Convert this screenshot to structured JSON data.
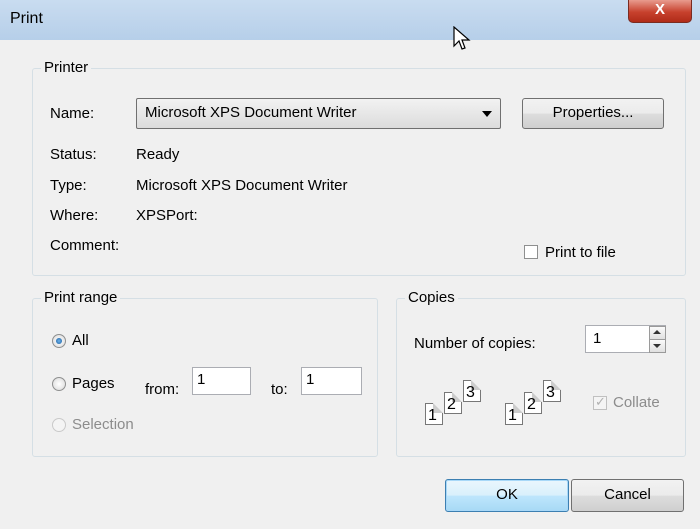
{
  "window": {
    "title": "Print",
    "close_glyph": "X"
  },
  "printer": {
    "legend": "Printer",
    "name_label": "Name:",
    "name_value": "Microsoft XPS Document Writer",
    "properties_label": "Properties...",
    "status_label": "Status:",
    "status_value": "Ready",
    "type_label": "Type:",
    "type_value": "Microsoft XPS Document Writer",
    "where_label": "Where:",
    "where_value": "XPSPort:",
    "comment_label": "Comment:",
    "print_to_file_label": "Print to file",
    "print_to_file_checked": false
  },
  "range": {
    "legend": "Print range",
    "all_label": "All",
    "pages_label": "Pages",
    "from_label": "from:",
    "from_value": "1",
    "to_label": "to:",
    "to_value": "1",
    "selection_label": "Selection",
    "selected": "All"
  },
  "copies": {
    "legend": "Copies",
    "number_label": "Number of copies:",
    "number_value": "1",
    "collate_label": "Collate",
    "collate_checked": true,
    "pages_a": [
      "1",
      "2",
      "3"
    ],
    "pages_b": [
      "1",
      "2",
      "3"
    ]
  },
  "buttons": {
    "ok": "OK",
    "cancel": "Cancel"
  },
  "colors": {
    "titlebar": "#c4d8ee",
    "close": "#c7412d",
    "accent": "#3c7fb1"
  },
  "icons": [
    "close-icon",
    "dropdown-arrow-icon",
    "spin-up-icon",
    "spin-down-icon",
    "mouse-cursor-icon",
    "collate-pages-icon"
  ]
}
